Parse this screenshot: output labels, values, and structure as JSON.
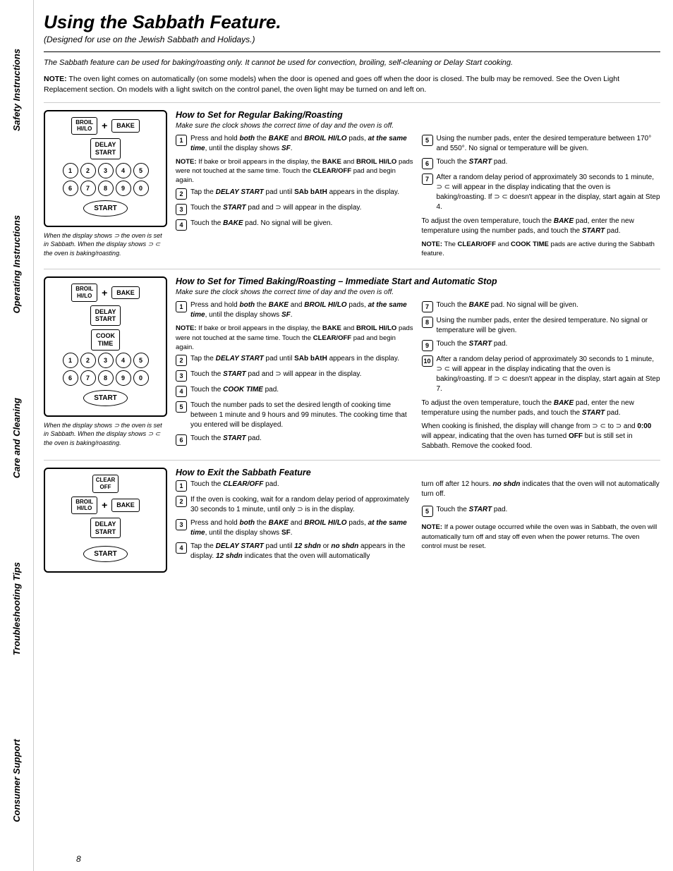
{
  "sidebar": {
    "sections": [
      "Safety Instructions",
      "Operating Instructions",
      "Care and Cleaning",
      "Troubleshooting Tips",
      "Consumer Support"
    ]
  },
  "page": {
    "title": "Using the Sabbath Feature.",
    "subtitle": "(Designed for use on the Jewish Sabbath and Holidays.)",
    "intro": "The Sabbath feature can be used for baking/roasting only. It cannot be used for convection, broiling, self-cleaning or Delay Start cooking.",
    "note": "NOTE: The oven light comes on automatically (on some models) when the door is opened and goes off when the door is closed. The bulb may be removed. See the Oven Light Replacement section. On models with a light switch on the control panel, the oven light may be turned on and left on.",
    "page_number": "8"
  },
  "section1": {
    "title": "How to Set for Regular Baking/Roasting",
    "subtitle": "Make sure the clock shows the correct time of day and the oven is off.",
    "diagram_caption": "When the display shows ⊃ the oven is set in Sabbath. When the display shows ⊃ ⊂ the oven is baking/roasting.",
    "steps_left": [
      {
        "num": "1",
        "text": "Press and hold both the BAKE and BROIL HI/LO pads, at the same time, until the display shows SF."
      },
      {
        "num": "",
        "text": "NOTE: If bake or broil appears in the display, the BAKE and BROIL HI/LO pads were not touched at the same time. Touch the CLEAR/OFF pad and begin again.",
        "is_note": true
      },
      {
        "num": "2",
        "text": "Tap the DELAY START pad until SAb bAtH appears in the display."
      },
      {
        "num": "3",
        "text": "Touch the START pad and ⊃ will appear in the display."
      },
      {
        "num": "4",
        "text": "Touch the BAKE pad. No signal will be given."
      }
    ],
    "steps_right": [
      {
        "num": "5",
        "text": "Using the number pads, enter the desired temperature between 170° and 550°. No signal or temperature will be given."
      },
      {
        "num": "6",
        "text": "Touch the START pad."
      },
      {
        "num": "7",
        "text": "After a random delay period of approximately 30 seconds to 1 minute, ⊃ ⊂ will appear in the display indicating that the oven is baking/roasting. If ⊃ ⊂ doesn't appear in the display, start again at Step 4."
      }
    ],
    "adjust_text": "To adjust the oven temperature, touch the BAKE pad, enter the new temperature using the number pads, and touch the START pad.",
    "note_bottom": "NOTE: The CLEAR/OFF and COOK TIME pads are active during the Sabbath feature."
  },
  "section2": {
    "title": "How to Set for Timed Baking/Roasting – Immediate Start and Automatic Stop",
    "subtitle": "Make sure the clock shows the correct time of day and the oven is off.",
    "diagram_caption": "When the display shows ⊃ the oven is set in Sabbath. When the display shows ⊃ ⊂ the oven is baking/roasting.",
    "steps_left": [
      {
        "num": "1",
        "text": "Press and hold both the BAKE and BROIL HI/LO pads, at the same time, until the display shows SF."
      },
      {
        "num": "",
        "text": "NOTE: If bake or broil appears in the display, the BAKE and BROIL HI/LO pads were not touched at the same time. Touch the CLEAR/OFF pad and begin again.",
        "is_note": true
      },
      {
        "num": "2",
        "text": "Tap the DELAY START pad until SAb bAtH appears in the display."
      },
      {
        "num": "3",
        "text": "Touch the START pad and ⊃ will appear in the display."
      },
      {
        "num": "4",
        "text": "Touch the COOK TIME pad."
      },
      {
        "num": "5",
        "text": "Touch the number pads to set the desired length of cooking time between 1 minute and 9 hours and 99 minutes. The cooking time that you entered will be displayed."
      },
      {
        "num": "6",
        "text": "Touch the START pad."
      }
    ],
    "steps_right": [
      {
        "num": "7",
        "text": "Touch the BAKE pad. No signal will be given."
      },
      {
        "num": "8",
        "text": "Using the number pads, enter the desired temperature. No signal or temperature will be given."
      },
      {
        "num": "9",
        "text": "Touch the START pad."
      },
      {
        "num": "10",
        "text": "After a random delay period of approximately 30 seconds to 1 minute, ⊃ ⊂ will appear in the display indicating that the oven is baking/roasting. If ⊃ ⊂ doesn't appear in the display, start again at Step 7."
      }
    ],
    "adjust_text": "To adjust the oven temperature, touch the BAKE pad, enter the new temperature using the number pads, and touch the START pad.",
    "finished_text": "When cooking is finished, the display will change from ⊃ ⊂ to ⊃ and 0:00 will appear, indicating that the oven has turned OFF but is still set in Sabbath. Remove the cooked food."
  },
  "section3": {
    "title": "How to Exit the Sabbath Feature",
    "diagram_caption": "",
    "steps_left": [
      {
        "num": "1",
        "text": "Touch the CLEAR/OFF pad."
      },
      {
        "num": "2",
        "text": "If the oven is cooking, wait for a random delay period of approximately 30 seconds to 1 minute, until only ⊃ is in the display."
      },
      {
        "num": "3",
        "text": "Press and hold both the BAKE and BROIL HI/LO pads, at the same time, until the display shows SF."
      },
      {
        "num": "4",
        "text": "Tap the DELAY START pad until 12 shdn or no shdn appears in the display. 12 shdn indicates that the oven will automatically"
      }
    ],
    "steps_right": [
      {
        "num": "",
        "text": "turn off after 12 hours. no shdn indicates that the oven will not automatically turn off.",
        "is_continuation": true
      },
      {
        "num": "5",
        "text": "Touch the START pad."
      }
    ],
    "note_bottom": "NOTE: If a power outage occurred while the oven was in Sabbath, the oven will automatically turn off and stay off even when the power returns. The oven control must be reset."
  }
}
